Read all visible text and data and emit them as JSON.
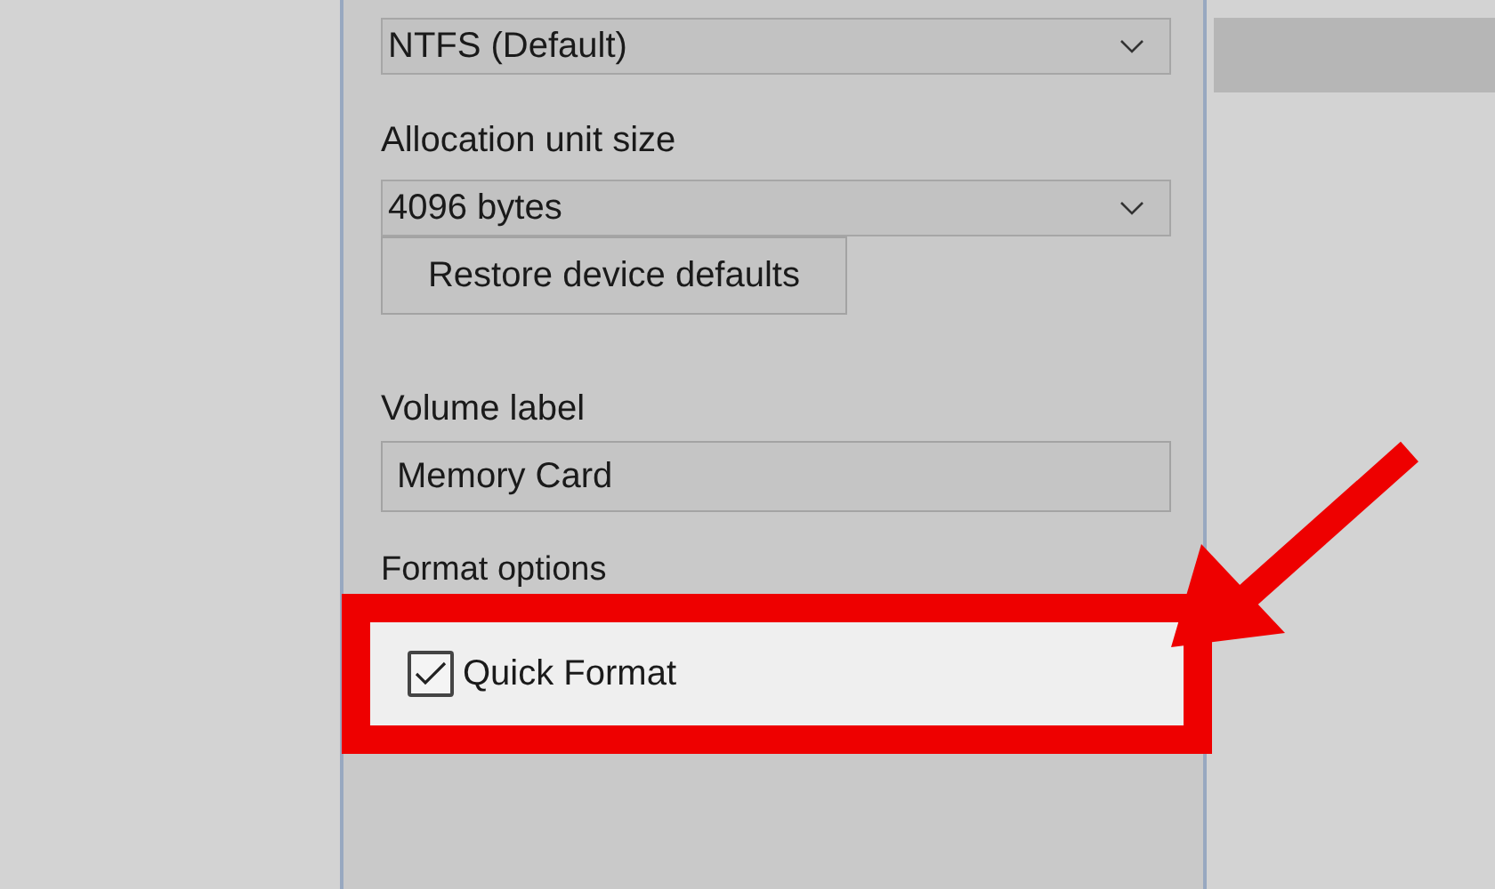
{
  "file_system": {
    "value": "NTFS (Default)"
  },
  "allocation_unit_size": {
    "label": "Allocation unit size",
    "value": "4096 bytes"
  },
  "restore_button": {
    "label": "Restore device defaults"
  },
  "volume_label": {
    "label": "Volume label",
    "value": "Memory Card"
  },
  "format_options": {
    "label": "Format options",
    "options": [
      {
        "label": "Quick Format",
        "checked": true
      }
    ]
  }
}
